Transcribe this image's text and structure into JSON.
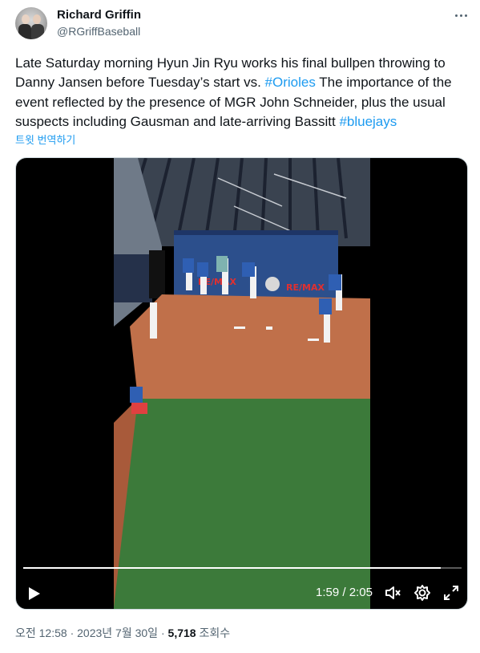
{
  "author": {
    "name": "Richard Griffin",
    "handle": "@RGriffBaseball"
  },
  "tweet": {
    "text_1": "Late Saturday morning Hyun Jin Ryu works his final bullpen throwing to Danny Jansen before Tuesday’s start vs. ",
    "hashtag_1": "#Orioles",
    "text_2": " The importance of the event reflected by the presence of MGR John Schneider, plus the usual suspects including Gausman and late-arriving Bassitt ",
    "hashtag_2": "#bluejays",
    "translate_label": "트윗 번역하기"
  },
  "video": {
    "current_time": "1:59",
    "separator": " / ",
    "duration": "2:05",
    "progress": 0.952,
    "banner_left": "RE/MAX",
    "banner_right": "RE/MAX"
  },
  "meta": {
    "time": "오전 12:58",
    "dot1": " · ",
    "date": "2023년 7월 30일",
    "dot2": " · ",
    "views": "5,718",
    "views_label": " 조회수"
  },
  "colors": {
    "link": "#1d9bf0",
    "secondary_text": "#536471",
    "mound_dirt": "#c0704a",
    "grass": "#3c7a3a",
    "banner": "#2c4f8c"
  },
  "icons": [
    "more-icon",
    "play-icon",
    "volume-icon",
    "settings-icon",
    "fullscreen-icon"
  ]
}
